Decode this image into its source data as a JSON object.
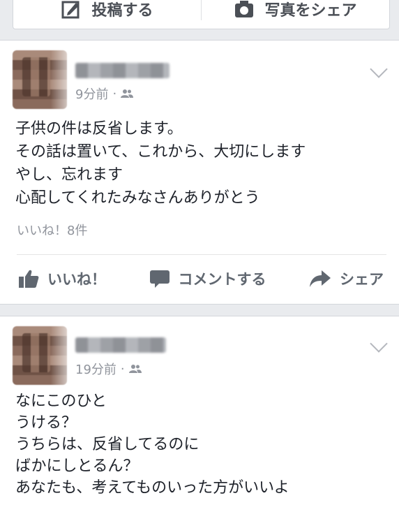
{
  "composer": {
    "post_label": "投稿する",
    "photo_label": "写真をシェア"
  },
  "posts": [
    {
      "time": "9分前",
      "audience_icon": "friends-icon",
      "text": "子供の件は反省します。\nその話は置いて、これから、大切にします\nやし、忘れます\n心配してくれたみなさんありがとう",
      "likes": "いいね！8件",
      "actions": {
        "like": "いいね！",
        "comment": "コメントする",
        "share": "シェア"
      }
    },
    {
      "time": "19分前",
      "audience_icon": "friends-icon",
      "text": "なにこのひと\nうける？\nうちらは、反省してるのに\nばかにしとるん？\nあなたも、考えてものいった方がいいよ"
    }
  ],
  "colors": {
    "background": "#e9ebee",
    "meta_text": "#90949c",
    "action_text": "#606770"
  }
}
